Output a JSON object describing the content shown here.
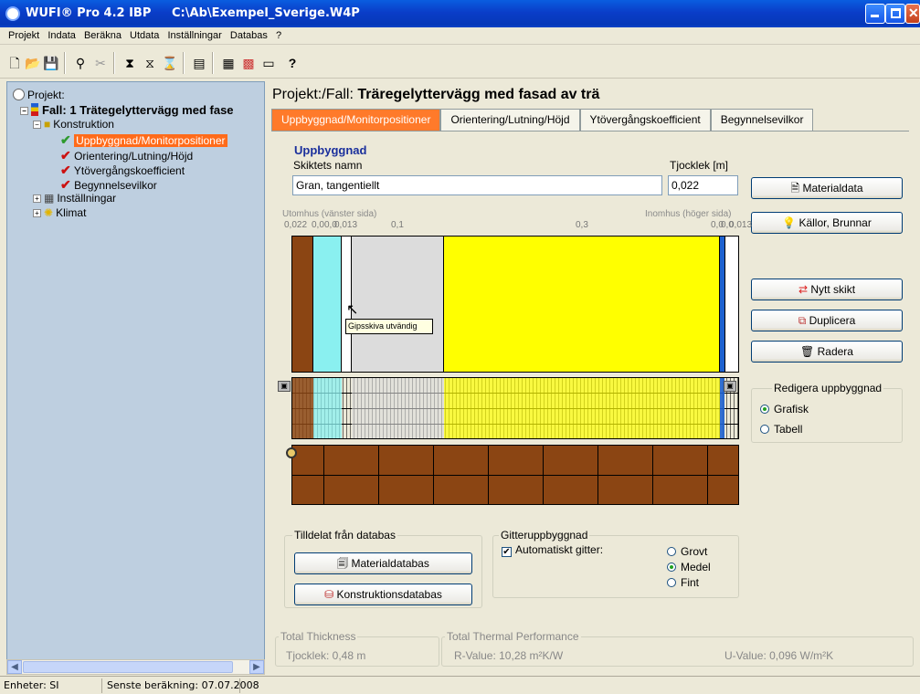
{
  "window": {
    "app_title": "WUFI® Pro 4.2 IBP",
    "file_path": "C:\\Ab\\Exempel_Sverige.W4P"
  },
  "menu": [
    "Projekt",
    "Indata",
    "Beräkna",
    "Utdata",
    "Inställningar",
    "Databas",
    "?"
  ],
  "toolbar": {
    "help_label": "?"
  },
  "tree": {
    "root_label": "Projekt:",
    "case_label": "Fall: 1 Trätegelyttervägg med fase",
    "construction_label": "Konstruktion",
    "items": [
      {
        "label": "Uppbyggnad/Monitorpositioner",
        "check_color": "#2e9a2e",
        "selected": true
      },
      {
        "label": "Orientering/Lutning/Höjd",
        "check_color": "#cc1111"
      },
      {
        "label": "Ytövergångskoefficient",
        "check_color": "#cc1111"
      },
      {
        "label": "Begynnelsevilkor",
        "check_color": "#cc1111"
      }
    ],
    "settings_label": "Inställningar",
    "climate_label": "Klimat"
  },
  "main": {
    "breadcrumb_prefix": "Projekt:/Fall:",
    "breadcrumb_title": "Träregelyttervägg med fasad av trä",
    "tabs": [
      "Uppbyggnad/Monitorpositioner",
      "Orientering/Lutning/Höjd",
      "Ytövergångskoefficient",
      "Begynnelsevilkor"
    ],
    "section_title": "Uppbyggnad",
    "layer_name_label": "Skiktets namn",
    "layer_name_value": "Gran, tangentiellt",
    "thickness_label": "Tjocklek [m]",
    "thickness_value": "0,022",
    "outside_label": "Utomhus (vänster sida)",
    "inside_label": "Inomhus (höger sida)",
    "thickness_ticks": [
      "0,022",
      "0,0",
      "0,0",
      "0,013",
      "0,1",
      "0,3",
      "0,0",
      "0,0",
      "0,013"
    ],
    "tooltip": "Gipsskiva utvändig",
    "buttons": {
      "material_data": "Materialdata",
      "sources": "Källor, Brunnar",
      "new_layer": "Nytt skikt",
      "duplicate": "Duplicera",
      "delete": "Radera",
      "material_db": "Materialdatabas",
      "construction_db": "Konstruktionsdatabas"
    },
    "edit_group": {
      "title": "Redigera uppbyggnad",
      "options": [
        "Grafisk",
        "Tabell"
      ],
      "selected": "Grafisk"
    },
    "assigned_group": {
      "title": "Tilldelat från databas"
    },
    "grid_group": {
      "title": "Gitteruppbyggnad",
      "auto_label": "Automatiskt gitter:",
      "auto_checked": true,
      "options": [
        "Grovt",
        "Medel",
        "Fint"
      ],
      "selected": "Medel"
    },
    "total_thickness": {
      "title": "Total Thickness",
      "value": "Tjocklek: 0,48 m"
    },
    "thermal": {
      "title": "Total Thermal Performance",
      "r_value": "R-Value: 10,28 m²K/W",
      "u_value": "U-Value: 0,096 W/m²K"
    },
    "layer_colors": {
      "wood": "#8B4513",
      "cyan": "#8AF0F0",
      "white": "#FFFFFF",
      "grey": "#DCDCDC",
      "yellow": "#FFFF00",
      "blue": "#1E62D0"
    }
  },
  "status": {
    "units": "Enheter: SI",
    "last_calc": "Senste beräkning: 07.07.2008"
  }
}
